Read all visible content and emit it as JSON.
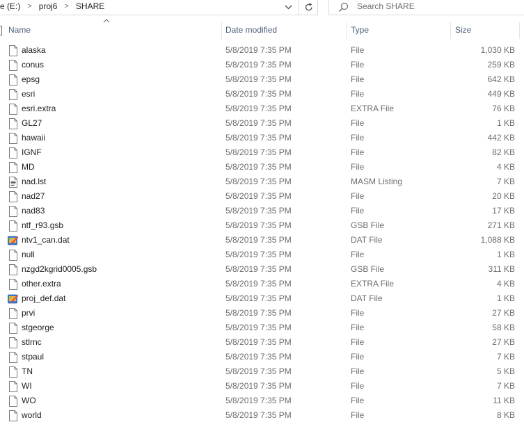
{
  "address": {
    "crumbs": [
      "e (E:)",
      "proj6",
      "SHARE"
    ],
    "separator": ">"
  },
  "search": {
    "placeholder": "Search SHARE"
  },
  "columns": {
    "name": "Name",
    "date": "Date modified",
    "type": "Type",
    "size": "Size"
  },
  "files": [
    {
      "name": "alaska",
      "date": "5/8/2019 7:35 PM",
      "type": "File",
      "size": "1,030 KB",
      "icon": "file-icon"
    },
    {
      "name": "conus",
      "date": "5/8/2019 7:35 PM",
      "type": "File",
      "size": "259 KB",
      "icon": "file-icon"
    },
    {
      "name": "epsg",
      "date": "5/8/2019 7:35 PM",
      "type": "File",
      "size": "642 KB",
      "icon": "file-icon"
    },
    {
      "name": "esri",
      "date": "5/8/2019 7:35 PM",
      "type": "File",
      "size": "449 KB",
      "icon": "file-icon"
    },
    {
      "name": "esri.extra",
      "date": "5/8/2019 7:35 PM",
      "type": "EXTRA File",
      "size": "76 KB",
      "icon": "file-icon"
    },
    {
      "name": "GL27",
      "date": "5/8/2019 7:35 PM",
      "type": "File",
      "size": "1 KB",
      "icon": "file-icon"
    },
    {
      "name": "hawaii",
      "date": "5/8/2019 7:35 PM",
      "type": "File",
      "size": "442 KB",
      "icon": "file-icon"
    },
    {
      "name": "IGNF",
      "date": "5/8/2019 7:35 PM",
      "type": "File",
      "size": "82 KB",
      "icon": "file-icon"
    },
    {
      "name": "MD",
      "date": "5/8/2019 7:35 PM",
      "type": "File",
      "size": "4 KB",
      "icon": "file-icon"
    },
    {
      "name": "nad.lst",
      "date": "5/8/2019 7:35 PM",
      "type": "MASM Listing",
      "size": "7 KB",
      "icon": "text-file-icon"
    },
    {
      "name": "nad27",
      "date": "5/8/2019 7:35 PM",
      "type": "File",
      "size": "20 KB",
      "icon": "file-icon"
    },
    {
      "name": "nad83",
      "date": "5/8/2019 7:35 PM",
      "type": "File",
      "size": "17 KB",
      "icon": "file-icon"
    },
    {
      "name": "ntf_r93.gsb",
      "date": "5/8/2019 7:35 PM",
      "type": "GSB File",
      "size": "271 KB",
      "icon": "file-icon"
    },
    {
      "name": "ntv1_can.dat",
      "date": "5/8/2019 7:35 PM",
      "type": "DAT File",
      "size": "1,088 KB",
      "icon": "dat-file-icon"
    },
    {
      "name": "null",
      "date": "5/8/2019 7:35 PM",
      "type": "File",
      "size": "1 KB",
      "icon": "file-icon"
    },
    {
      "name": "nzgd2kgrid0005.gsb",
      "date": "5/8/2019 7:35 PM",
      "type": "GSB File",
      "size": "311 KB",
      "icon": "file-icon"
    },
    {
      "name": "other.extra",
      "date": "5/8/2019 7:35 PM",
      "type": "EXTRA File",
      "size": "4 KB",
      "icon": "file-icon"
    },
    {
      "name": "proj_def.dat",
      "date": "5/8/2019 7:35 PM",
      "type": "DAT File",
      "size": "1 KB",
      "icon": "dat-file-icon"
    },
    {
      "name": "prvi",
      "date": "5/8/2019 7:35 PM",
      "type": "File",
      "size": "27 KB",
      "icon": "file-icon"
    },
    {
      "name": "stgeorge",
      "date": "5/8/2019 7:35 PM",
      "type": "File",
      "size": "58 KB",
      "icon": "file-icon"
    },
    {
      "name": "stlrnc",
      "date": "5/8/2019 7:35 PM",
      "type": "File",
      "size": "27 KB",
      "icon": "file-icon"
    },
    {
      "name": "stpaul",
      "date": "5/8/2019 7:35 PM",
      "type": "File",
      "size": "7 KB",
      "icon": "file-icon"
    },
    {
      "name": "TN",
      "date": "5/8/2019 7:35 PM",
      "type": "File",
      "size": "5 KB",
      "icon": "file-icon"
    },
    {
      "name": "WI",
      "date": "5/8/2019 7:35 PM",
      "type": "File",
      "size": "7 KB",
      "icon": "file-icon"
    },
    {
      "name": "WO",
      "date": "5/8/2019 7:35 PM",
      "type": "File",
      "size": "11 KB",
      "icon": "file-icon"
    },
    {
      "name": "world",
      "date": "5/8/2019 7:35 PM",
      "type": "File",
      "size": "8 KB",
      "icon": "file-icon"
    }
  ]
}
